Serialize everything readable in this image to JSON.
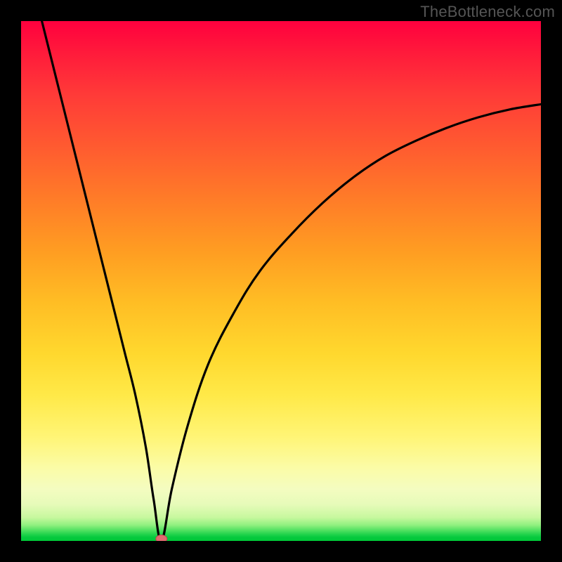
{
  "watermark": "TheBottleneck.com",
  "colors": {
    "frame": "#000000",
    "curve": "#000000",
    "marker_fill": "#e06a6f",
    "marker_stroke": "#b94a50"
  },
  "chart_data": {
    "type": "line",
    "title": "",
    "xlabel": "",
    "ylabel": "",
    "xlim": [
      0,
      100
    ],
    "ylim": [
      0,
      100
    ],
    "grid": false,
    "legend": false,
    "series": [
      {
        "name": "bottleneck-curve",
        "x": [
          4,
          6,
          8,
          10,
          12,
          14,
          16,
          18,
          20,
          22,
          24,
          25.5,
          27,
          29,
          32,
          36,
          41,
          46,
          52,
          58,
          64,
          70,
          76,
          82,
          88,
          94,
          100
        ],
        "y": [
          100,
          92,
          84,
          76,
          68,
          60,
          52,
          44,
          36,
          28,
          18,
          8,
          0,
          10,
          22,
          34,
          44,
          52,
          59,
          65,
          70,
          74,
          77,
          79.5,
          81.5,
          83,
          84
        ]
      }
    ],
    "markers": [
      {
        "name": "min-point",
        "x": 27,
        "y": 0
      }
    ]
  }
}
